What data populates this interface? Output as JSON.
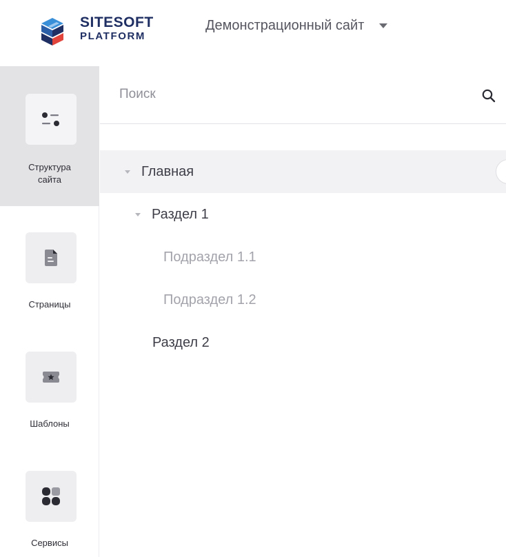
{
  "header": {
    "brand_line1": "SITESOFT",
    "brand_line2": "PLATFORM",
    "site_selector": {
      "value": "Демонстрационный сайт",
      "icon": "caret-down-icon"
    }
  },
  "sidebar": {
    "items": [
      {
        "label_line1": "Структура",
        "label_line2": "сайта",
        "icon": "site-structure-icon",
        "active": true
      },
      {
        "label": "Страницы",
        "icon": "page-document-icon",
        "active": false
      },
      {
        "label": "Шаблоны",
        "icon": "template-star-icon",
        "active": false
      },
      {
        "label": "Сервисы",
        "icon": "services-grid-icon",
        "active": false
      }
    ]
  },
  "main": {
    "search": {
      "placeholder": "Поиск",
      "icon": "search-icon"
    },
    "tree": [
      {
        "label": "Главная",
        "level": 0,
        "expanded": true,
        "selected": true
      },
      {
        "label": "Раздел 1",
        "level": 1,
        "expanded": true,
        "selected": false
      },
      {
        "label": "Подраздел 1.1",
        "level": 2,
        "muted": true
      },
      {
        "label": "Подраздел 1.2",
        "level": 2,
        "muted": true
      },
      {
        "label": "Раздел 2",
        "level": 1,
        "expanded": false
      }
    ]
  },
  "colors": {
    "brand": "#1f2f63",
    "logo_blue": "#3a8fd9",
    "logo_red": "#e0443a",
    "logo_navy": "#1f2f63",
    "active_rail": "#e3e2e5",
    "selected_row": "#f2f2f4"
  }
}
